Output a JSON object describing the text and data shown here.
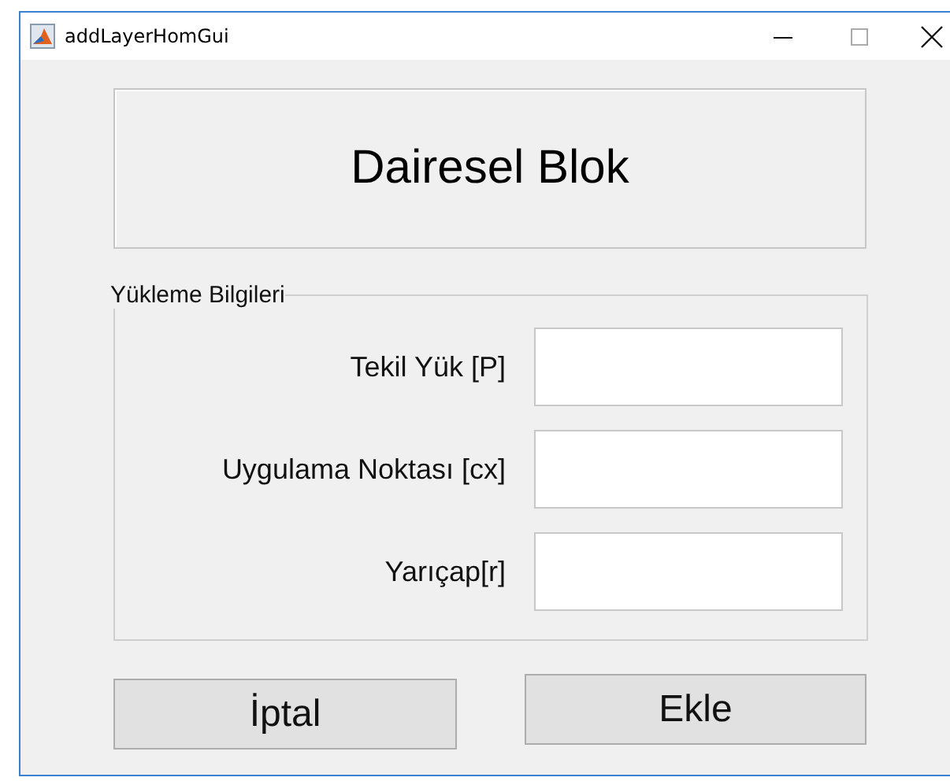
{
  "window": {
    "title": "addLayerHomGui"
  },
  "heading": "Dairesel Blok",
  "group": {
    "title": "Yükleme Bilgileri",
    "fields": [
      {
        "label": "Tekil Yük [P]"
      },
      {
        "label": "Uygulama Noktası [cx]"
      },
      {
        "label": "Yarıçap[r]"
      }
    ]
  },
  "buttons": [
    "İptal",
    "Ekle"
  ]
}
